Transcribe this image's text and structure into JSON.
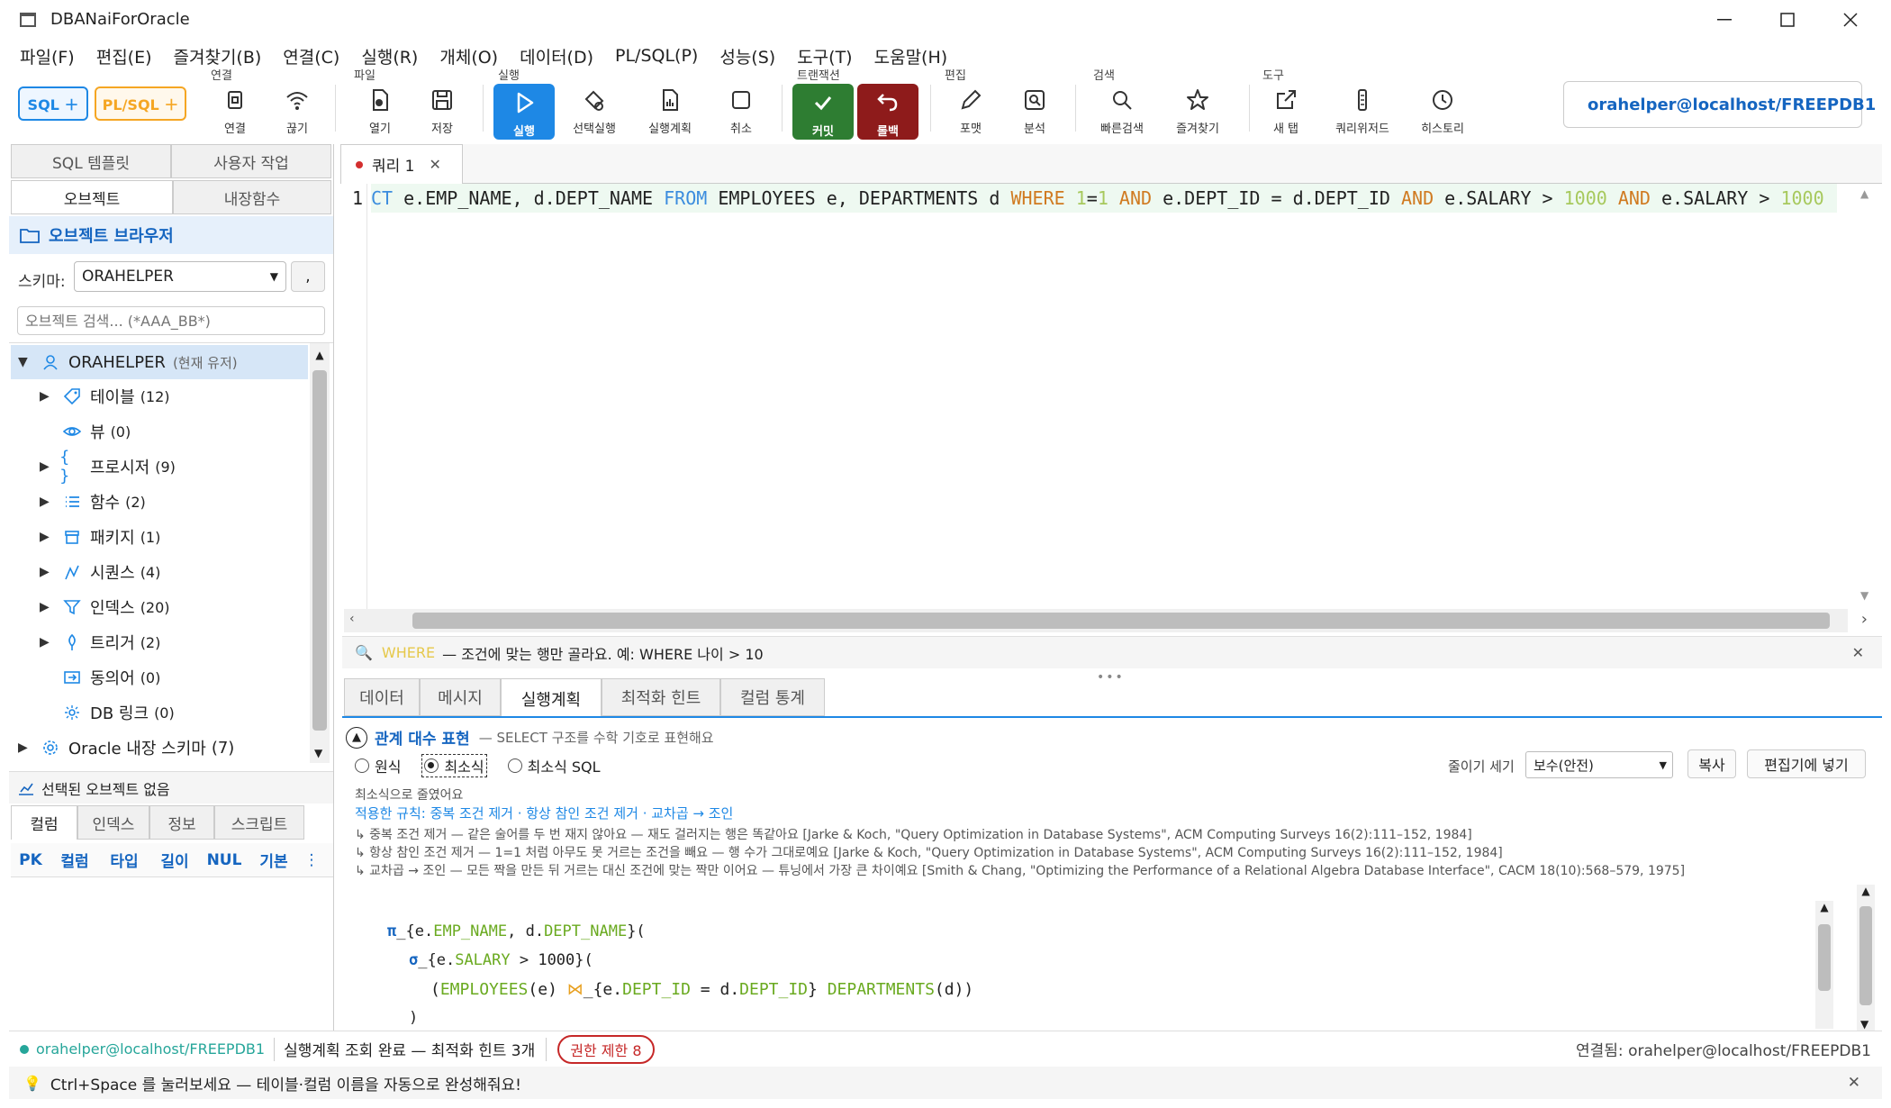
{
  "window": {
    "title": "DBANaiForOracle"
  },
  "menu": [
    "파일(F)",
    "편집(E)",
    "즐겨찾기(B)",
    "연결(C)",
    "실행(R)",
    "개체(O)",
    "데이터(D)",
    "PL/SQL(P)",
    "성능(S)",
    "도구(T)",
    "도움말(H)"
  ],
  "ribbon": {
    "sql_btn": "SQL ＋",
    "plsql_btn": "PL/SQL ＋",
    "groups": {
      "conn": "연결",
      "file": "파일",
      "run": "실행",
      "tx": "트랜잭션",
      "edit": "편집",
      "search": "검색",
      "tools": "도구"
    },
    "buttons": {
      "connect": "연결",
      "disconnect": "끊기",
      "open": "열기",
      "save": "저장",
      "run": "실행",
      "run_sel": "선택실행",
      "plan": "실행계획",
      "cancel": "취소",
      "commit": "커밋",
      "rollback": "롤백",
      "format": "포맷",
      "analyze": "분석",
      "quick_search": "빠른검색",
      "favorites": "즐겨찾기",
      "new_tab": "새 탭",
      "query_wizard": "쿼리위저드",
      "history": "히스토리"
    },
    "connection": "orahelper@localhost/FREEPDB1"
  },
  "left": {
    "tabs_top": [
      "SQL 템플릿",
      "사용자 작업"
    ],
    "tabs_second": [
      "오브젝트",
      "내장함수"
    ],
    "browser_title": "오브젝트 브라우저",
    "schema_label": "스키마:",
    "schema_value": "ORAHELPER",
    "schema_btn": ",",
    "search_placeholder": "오브젝트 검색... (*AAA_BB*)",
    "root": {
      "name": "ORAHELPER",
      "note": "(현재 유저)"
    },
    "items": [
      {
        "label": "테이블",
        "count": "(12)",
        "icon": "tag-icon",
        "arrow": true
      },
      {
        "label": "뷰",
        "count": "(0)",
        "icon": "eye-icon",
        "arrow": false
      },
      {
        "label": "프로시저",
        "count": "(9)",
        "icon": "braces-icon",
        "arrow": true
      },
      {
        "label": "함수",
        "count": "(2)",
        "icon": "list-icon",
        "arrow": true
      },
      {
        "label": "패키지",
        "count": "(1)",
        "icon": "box-icon",
        "arrow": true
      },
      {
        "label": "시퀀스",
        "count": "(4)",
        "icon": "sequence-icon",
        "arrow": true
      },
      {
        "label": "인덱스",
        "count": "(20)",
        "icon": "filter-icon",
        "arrow": true
      },
      {
        "label": "트리거",
        "count": "(2)",
        "icon": "trigger-icon",
        "arrow": true
      },
      {
        "label": "동의어",
        "count": "(0)",
        "icon": "synonym-icon",
        "arrow": false
      },
      {
        "label": "DB 링크",
        "count": "(0)",
        "icon": "link-icon",
        "arrow": false
      }
    ],
    "builtin": {
      "label": "Oracle 내장 스키마",
      "count": "(7)"
    },
    "selected_none": "선택된 오브젝트 없음",
    "detail_tabs": [
      "컬럼",
      "인덱스",
      "정보",
      "스크립트"
    ],
    "col_headers": [
      "PK",
      "컬럼",
      "타입",
      "길이",
      "NUL",
      "기본",
      "⋮"
    ]
  },
  "editor": {
    "tab_label": "쿼리 1",
    "line_no": "1",
    "sql_tokens": [
      {
        "t": "CT",
        "c": "kw2"
      },
      {
        "t": " e.EMP_NAME, d.DEPT_NAME ",
        "c": ""
      },
      {
        "t": "FROM",
        "c": "kw2"
      },
      {
        "t": " EMPLOYEES e, DEPARTMENTS d ",
        "c": ""
      },
      {
        "t": "WHERE",
        "c": "kw"
      },
      {
        "t": " ",
        "c": ""
      },
      {
        "t": "1",
        "c": "num"
      },
      {
        "t": "=",
        "c": ""
      },
      {
        "t": "1",
        "c": "num"
      },
      {
        "t": " ",
        "c": ""
      },
      {
        "t": "AND",
        "c": "kw"
      },
      {
        "t": " e.DEPT_ID = d.DEPT_ID ",
        "c": ""
      },
      {
        "t": "AND",
        "c": "kw"
      },
      {
        "t": " e.SALARY > ",
        "c": ""
      },
      {
        "t": "1000",
        "c": "num"
      },
      {
        "t": " ",
        "c": ""
      },
      {
        "t": "AND",
        "c": "kw"
      },
      {
        "t": " e.SALARY > ",
        "c": ""
      },
      {
        "t": "1000",
        "c": "num"
      }
    ],
    "hint_keyword": "WHERE",
    "hint_text": "— 조건에 맞는 행만 골라요. 예: WHERE 나이 > 10"
  },
  "result": {
    "tabs": [
      "데이터",
      "메시지",
      "실행계획",
      "최적화 힌트",
      "컬럼 통계"
    ],
    "section_title": "관계 대수 표현",
    "section_sub": "— SELECT 구조를 수학 기호로 표현해요",
    "radios": [
      "원식",
      "최소식",
      "최소식 SQL"
    ],
    "reduce_label": "줄이기 세기",
    "reduce_value": "보수(안전)",
    "copy_btn": "복사",
    "insert_btn": "편집기에 넣기",
    "reduced_msg": "최소식으로 줄였어요",
    "applied_rules": "적용한 규칙: 중복 조건 제거 · 항상 참인 조건 제거 · 교차곱 → 조인",
    "citations": [
      "↳ 중복 조건 제거 — 같은 술어를 두 번 재지 않아요 — 재도 걸러지는 행은 똑같아요  [Jarke & Koch, \"Query Optimization in Database Systems\", ACM Computing Surveys 16(2):111–152, 1984]",
      "↳ 항상 참인 조건 제거 — 1=1 처럼 아무도 못 거르는 조건을 빼요 — 행 수가 그대로예요  [Jarke & Koch, \"Query Optimization in Database Systems\", ACM Computing Surveys 16(2):111–152, 1984]",
      "↳ 교차곱 → 조인 — 모든 짝을 만든 뒤 거르는 대신 조건에 맞는 짝만 이어요 — 튜닝에서 가장 큰 차이예요  [Smith & Chang, \"Optimizing the Performance of a Relational Algebra Database Interface\", CACM 18(10):568–579, 1975]"
    ]
  },
  "status": {
    "conn": "orahelper@localhost/FREEPDB1",
    "message": "실행계획 조회 완료 — 최적화 힌트 3개",
    "badge": "권한 제한 8",
    "connected": "연결됨: orahelper@localhost/FREEPDB1"
  },
  "hint_bar": "Ctrl+Space 를 눌러보세요 — 테이블·컬럼 이름을 자동으로 완성해줘요!",
  "colors": {
    "accent": "#1e88e5",
    "commit": "#2e7d32",
    "rollback": "#8e1b1b",
    "sql": "#1e88e5",
    "plsql": "#f5a623"
  }
}
